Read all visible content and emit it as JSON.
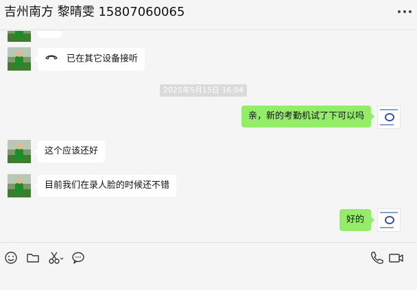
{
  "header": {
    "title": "吉州南方 黎晴雯 15807060065",
    "more_icon": "more-icon"
  },
  "messages": {
    "call": {
      "text": "已在其它设备接听",
      "icon": "phone-hangup-icon"
    },
    "timestamp": "2025年5月15日 16:04",
    "m1": "亲，新的考勤机试了下可以吗",
    "m2": "这个应该还好",
    "m3": "目前我们在录人脸的时候还不错",
    "m4": "好的"
  },
  "toolbar": {
    "left_icons": [
      "emoji-icon",
      "folder-icon",
      "screenshot-scissors-icon",
      "chat-history-icon"
    ],
    "right_icons": [
      "voice-call-icon",
      "video-call-icon"
    ]
  },
  "colors": {
    "self_bubble": "#95ec69",
    "other_bubble": "#ffffff",
    "background": "#f5f5f5"
  }
}
